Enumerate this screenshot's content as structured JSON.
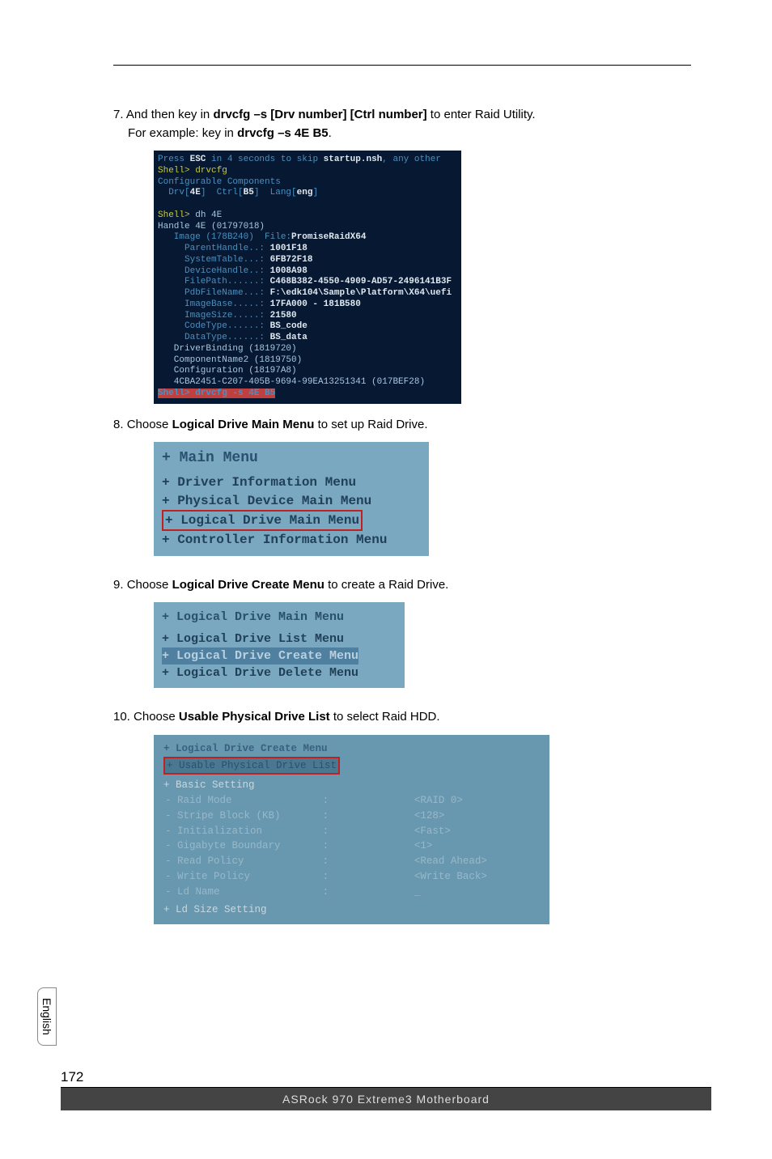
{
  "step7": {
    "num": "7.",
    "text_a": "And then key in ",
    "bold_a": "drvcfg –s [Drv number] [Ctrl number]",
    "text_b": " to enter Raid Utility.",
    "line2_a": "For example: key in ",
    "bold_b": "drvcfg –s 4E B5",
    "line2_b": "."
  },
  "terminal": {
    "l1a": "Press ",
    "l1b": "ESC",
    "l1c": " in 4 seconds to skip ",
    "l1d": "startup.nsh",
    "l1e": ", any other ",
    "l2": "Shell> drvcfg",
    "l3": "Configurable Components",
    "l4a": "  Drv[",
    "l4b": "4E",
    "l4c": "]  Ctrl[",
    "l4d": "B5",
    "l4e": "]  Lang[",
    "l4f": "eng",
    "l4g": "]",
    "l5": " ",
    "l6a": "Shell> ",
    "l6b": "dh 4E",
    "l7": "Handle 4E (01797018)",
    "l8a": "   Image (178B240)  File:",
    "l8b": "PromiseRaidX64",
    "l9a": "     ParentHandle..: ",
    "l9b": "1001F18",
    "l10a": "     SystemTable...: ",
    "l10b": "6FB72F18",
    "l11a": "     DeviceHandle..: ",
    "l11b": "1008A98",
    "l12a": "     FilePath......: ",
    "l12b": "C468B382-4550-4909-AD57-2496141B3F",
    "l13a": "     PdbFileName...: ",
    "l13b": "F:\\edk104\\Sample\\Platform\\X64\\uefi",
    "l14a": "     ImageBase.....: ",
    "l14b": "17FA000 - 181B580",
    "l15a": "     ImageSize.....: ",
    "l15b": "21580",
    "l16a": "     CodeType......: ",
    "l16b": "BS_code",
    "l17a": "     DataType......: ",
    "l17b": "BS_data",
    "l18": "   DriverBinding (1819720)",
    "l19": "   ComponentName2 (1819750)",
    "l20": "   Configuration (18197A8)",
    "l21": "   4CBA2451-C207-405B-9694-99EA13251341 (017BEF28)",
    "l22": "Shell> drvcfg -s 4E B5"
  },
  "step8": {
    "num": "8.",
    "text_a": "Choose ",
    "bold": "Logical Drive Main Menu",
    "text_b": " to set up Raid Drive."
  },
  "bios1": {
    "title": "+ Main Menu",
    "i1": "+ Driver Information Menu",
    "i2": "+ Physical Device Main Menu",
    "i3": "+ Logical Drive Main Menu",
    "i4": "+ Controller Information Menu"
  },
  "step9": {
    "num": "9.",
    "text_a": "Choose ",
    "bold": "Logical Drive Create Menu",
    "text_b": " to create a Raid Drive."
  },
  "bios2": {
    "title": "+ Logical Drive Main Menu",
    "i1": "+ Logical Drive List Menu",
    "i2": "+ Logical Drive Create Menu",
    "i3": "+ Logical Drive Delete Menu"
  },
  "step10": {
    "num": "10.",
    "text_a": "Choose ",
    "bold": "Usable Physical Drive List",
    "text_b": " to select Raid HDD."
  },
  "bios3": {
    "title": "+ Logical Drive Create Menu",
    "sel": "+ Usable Physical Drive List",
    "r0": "+ Basic Setting",
    "rows": [
      {
        "k": "- Raid Mode",
        "c": ":",
        "v": "<RAID 0>"
      },
      {
        "k": "- Stripe Block (KB)",
        "c": ":",
        "v": "<128>"
      },
      {
        "k": "- Initialization",
        "c": ":",
        "v": "<Fast>"
      },
      {
        "k": "- Gigabyte Boundary",
        "c": ":",
        "v": "<1>"
      },
      {
        "k": "- Read Policy",
        "c": ":",
        "v": "<Read Ahead>"
      },
      {
        "k": "- Write Policy",
        "c": ":",
        "v": "<Write Back>"
      },
      {
        "k": "- Ld Name",
        "c": ":",
        "v": "_"
      }
    ],
    "last": "+ Ld Size Setting"
  },
  "lang": "English",
  "pagenum": "172",
  "footer": "ASRock  970 Extreme3  Motherboard"
}
